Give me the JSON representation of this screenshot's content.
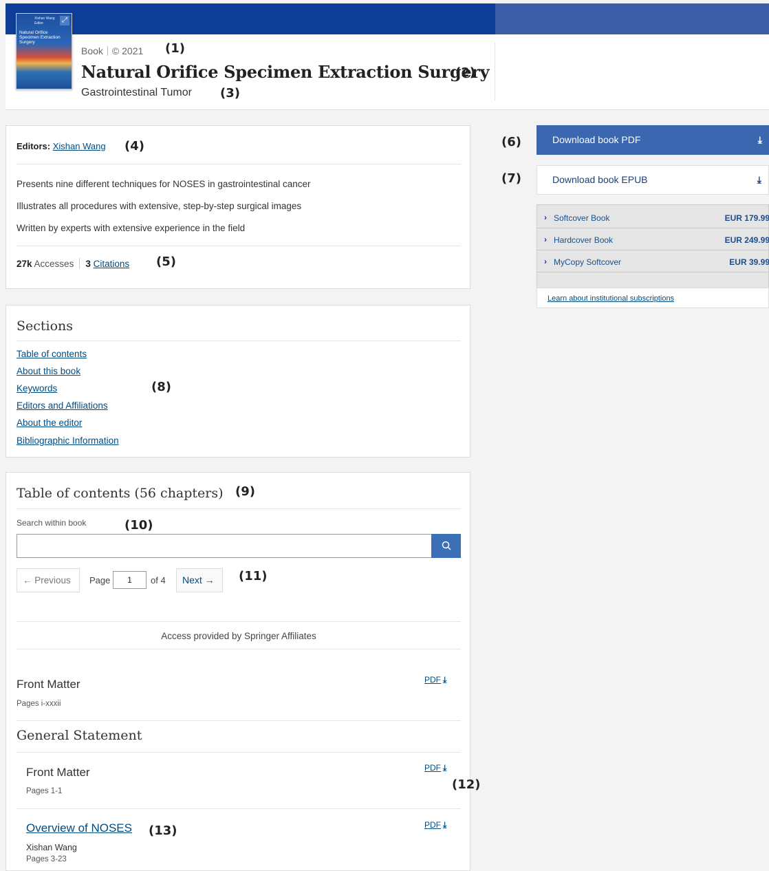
{
  "header": {
    "type": "Book",
    "year": "© 2021",
    "title": "Natural Orifice Specimen Extraction Surgery",
    "subtitle": "Gastrointestinal Tumor",
    "cover_lines": [
      "Natural Orifice",
      "Specimen Extraction",
      "Surgery"
    ]
  },
  "overview": {
    "editors_label": "Editors:",
    "editor_name": "Xishan Wang",
    "bullets": [
      "Presents nine different techniques for NOSES in gastrointestinal cancer",
      "Illustrates all procedures with extensive, step-by-step surgical images",
      "Written by experts with extensive experience in the field"
    ],
    "accesses_count": "27k",
    "accesses_label": "Accesses",
    "citations_count": "3",
    "citations_label": "Citations"
  },
  "sections": {
    "title": "Sections",
    "links": [
      "Table of contents",
      "About this book",
      "Keywords",
      "Editors and Affiliations",
      "About the editor",
      "Bibliographic Information"
    ]
  },
  "toc": {
    "title": "Table of contents (56 chapters)",
    "search_label": "Search within book",
    "search_placeholder": "",
    "prev_label": "← Previous",
    "page_label": "Page",
    "page_value": "1",
    "page_total": "of 4",
    "next_label": "Next →",
    "access_note": "Access provided by Springer Affiliates",
    "pdf_label": "PDF",
    "chapters": [
      {
        "title": "Front Matter",
        "pages": "Pages i-xxxii"
      },
      {
        "part_title": "General Statement"
      },
      {
        "title": "Front Matter",
        "pages": "Pages 1-1"
      },
      {
        "title": "Overview of NOSES",
        "author": "Xishan Wang",
        "pages": "Pages 3-23"
      }
    ]
  },
  "sidebar": {
    "download_pdf": "Download book PDF",
    "download_epub": "Download book EPUB",
    "purchase_options": [
      {
        "label": "Softcover Book",
        "price": "EUR 179.99"
      },
      {
        "label": "Hardcover Book",
        "price": "EUR 249.99"
      },
      {
        "label": "MyCopy Softcover",
        "price": "EUR 39.99"
      }
    ],
    "institutional_link": "Learn about institutional subscriptions"
  },
  "callouts": [
    "(1)",
    "(2)",
    "(3)",
    "(4)",
    "(5)",
    "(6)",
    "(7)",
    "(8)",
    "(9)",
    "(10)",
    "(11)",
    "(12)",
    "(13)"
  ],
  "colors": {
    "top_bar": "#0f3e98",
    "accent_button": "#3a67b0",
    "link": "#004b83"
  }
}
